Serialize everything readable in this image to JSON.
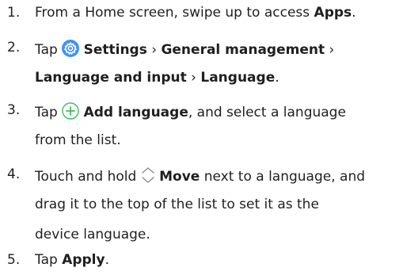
{
  "steps": [
    {
      "number": "1.",
      "line1": {
        "t1": "From a Home screen, swipe up to access ",
        "b1": "Apps",
        "t2": "."
      }
    },
    {
      "number": "2.",
      "line1": {
        "t1": "Tap ",
        "icon": "settings-gear-icon",
        "b1": "Settings",
        "sep1": " › ",
        "b2": "General management",
        "sep2": " ›"
      },
      "line2": {
        "b1": "Language and input",
        "sep1": " › ",
        "b2": "Language",
        "t1": "."
      }
    },
    {
      "number": "3.",
      "line1": {
        "t1": "Tap ",
        "icon": "add-plus-icon",
        "b1": "Add language",
        "t2": ", and select a language"
      },
      "line2": {
        "t1": "from the list."
      }
    },
    {
      "number": "4.",
      "line1": {
        "t1": "Touch and hold ",
        "icon": "move-chevrons-icon",
        "b1": "Move",
        "t2": " next to a language, and"
      },
      "line2": {
        "t1": "drag it to the top of the list to set it as the"
      },
      "line3": {
        "t1": "device language."
      }
    },
    {
      "number": "5.",
      "line1": {
        "t1": "Tap ",
        "b1": "Apply",
        "t2": "."
      }
    }
  ],
  "colors": {
    "text": "#1f1f1f",
    "accent_blue": "#3e91ff",
    "accent_green": "#3fbf5f",
    "move_icon": "#8a8a8a"
  }
}
